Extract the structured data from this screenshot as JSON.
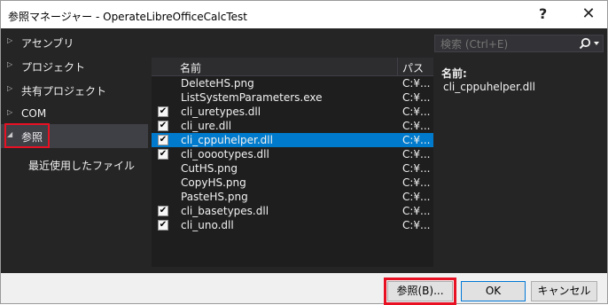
{
  "window": {
    "title": "参照マネージャー - OperateLibreOfficeCalcTest",
    "help_label": "?",
    "close_label": "✕"
  },
  "nav": {
    "items": [
      {
        "label": "アセンブリ",
        "arrow": "▷"
      },
      {
        "label": "プロジェクト",
        "arrow": "▷"
      },
      {
        "label": "共有プロジェクト",
        "arrow": "▷"
      },
      {
        "label": "COM",
        "arrow": "▷"
      },
      {
        "label": "参照",
        "arrow": "◢"
      },
      {
        "label": "最近使用したファイル",
        "arrow": ""
      }
    ]
  },
  "search": {
    "placeholder": "検索 (Ctrl+E)",
    "icon": "search-icon"
  },
  "list": {
    "columns": {
      "name": "名前",
      "path": "パス"
    },
    "rows": [
      {
        "checked": "",
        "name": "DeleteHS.png",
        "path": "C:¥..."
      },
      {
        "checked": "",
        "name": "ListSystemParameters.exe",
        "path": "C:¥..."
      },
      {
        "checked": "✔",
        "name": "cli_uretypes.dll",
        "path": "C:¥..."
      },
      {
        "checked": "✔",
        "name": "cli_ure.dll",
        "path": "C:¥..."
      },
      {
        "checked": "✔",
        "name": "cli_cppuhelper.dll",
        "path": "C:¥..."
      },
      {
        "checked": "✔",
        "name": "cli_ooootypes.dll",
        "path": "C:¥..."
      },
      {
        "checked": "",
        "name": "CutHS.png",
        "path": "C:¥..."
      },
      {
        "checked": "",
        "name": "CopyHS.png",
        "path": "C:¥..."
      },
      {
        "checked": "",
        "name": "PasteHS.png",
        "path": "C:¥..."
      },
      {
        "checked": "✔",
        "name": "cli_basetypes.dll",
        "path": "C:¥..."
      },
      {
        "checked": "✔",
        "name": "cli_uno.dll",
        "path": "C:¥..."
      }
    ]
  },
  "detail": {
    "label": "名前:",
    "value": "cli_cppuhelper.dll"
  },
  "footer": {
    "browse_label": "参照(B)...",
    "ok_label": "OK",
    "cancel_label": "キャンセル"
  },
  "colors": {
    "accent": "#007acc",
    "highlight": "#e81123",
    "panel": "#252526"
  }
}
